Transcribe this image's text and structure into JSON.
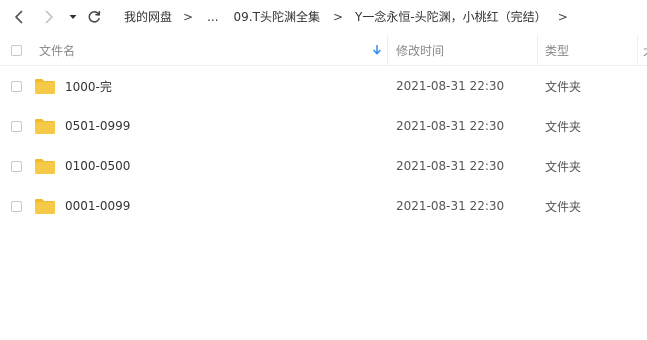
{
  "toolbar": {
    "back_icon": "chevron-left-icon",
    "forward_icon": "chevron-right-icon",
    "history_icon": "dropdown-caret-icon",
    "refresh_icon": "refresh-icon"
  },
  "breadcrumb": {
    "items": [
      "我的网盘",
      "...",
      "09.T头陀渊全集",
      "Y一念永恒-头陀渊，小桃红（完结）"
    ],
    "separator": ">"
  },
  "table": {
    "headers": {
      "name": "文件名",
      "modified": "修改时间",
      "type": "类型",
      "extra": "大"
    },
    "sort_icon": "sort-arrow-down-icon",
    "rows": [
      {
        "name": "1000-完",
        "modified": "2021-08-31 22:30",
        "type": "文件夹",
        "icon": "folder-icon"
      },
      {
        "name": "0501-0999",
        "modified": "2021-08-31 22:30",
        "type": "文件夹",
        "icon": "folder-icon"
      },
      {
        "name": "0100-0500",
        "modified": "2021-08-31 22:30",
        "type": "文件夹",
        "icon": "folder-icon"
      },
      {
        "name": "0001-0099",
        "modified": "2021-08-31 22:30",
        "type": "文件夹",
        "icon": "folder-icon"
      }
    ]
  },
  "colors": {
    "folder": "#F7C948",
    "folder_tab": "#F2B933",
    "accent": "#2f8ef2",
    "text": "#333333",
    "muted": "#888888"
  }
}
